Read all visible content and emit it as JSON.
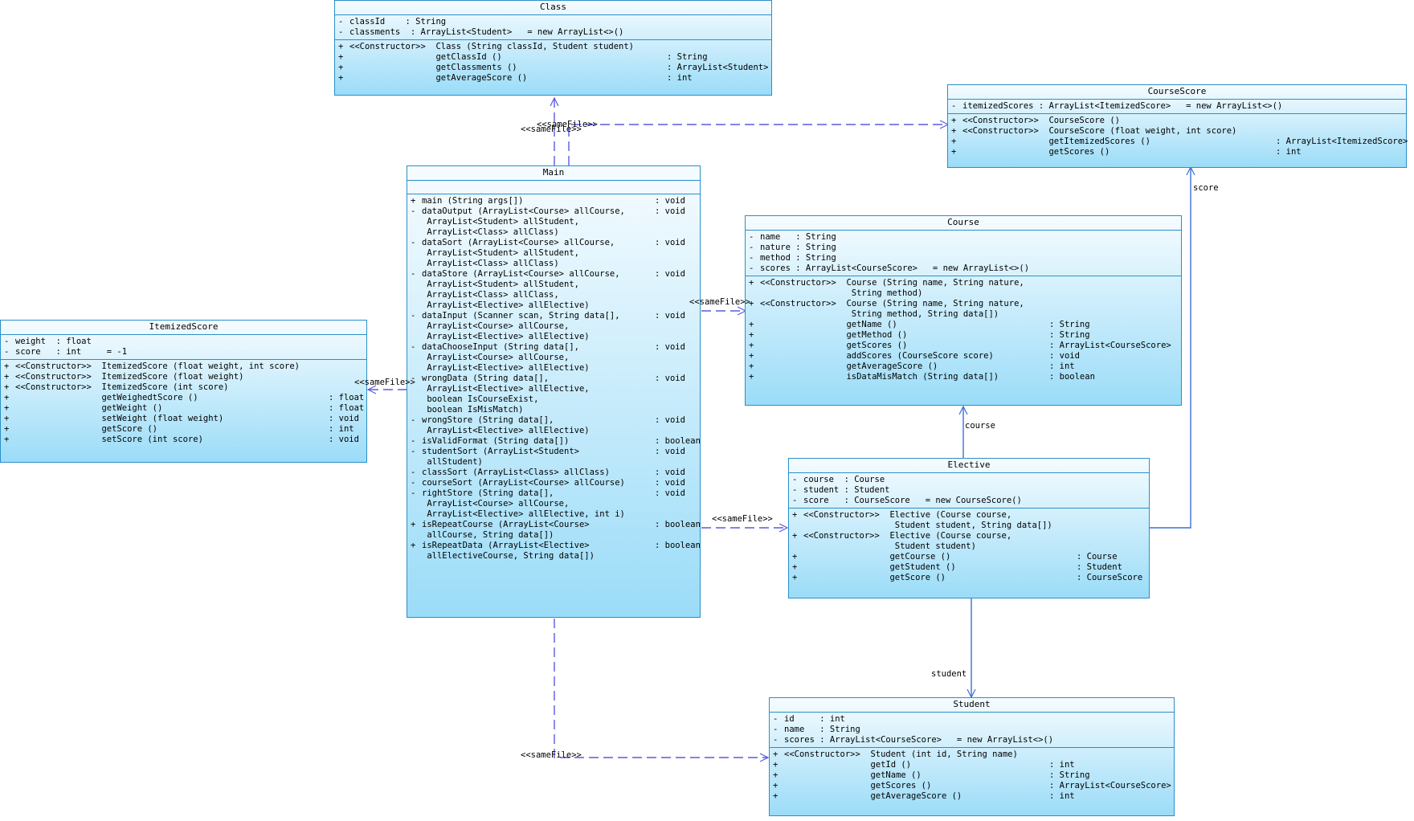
{
  "stereotype_label": "<<sameFile>>",
  "classes": {
    "class": {
      "title": "Class",
      "attrs": [
        {
          "vis": "-",
          "text": "classId    : String"
        },
        {
          "vis": "-",
          "text": "classments  : ArrayList<Student>   = new ArrayList<>()"
        }
      ],
      "ops": [
        {
          "vis": "+",
          "text": "<<Constructor>>  Class (String classId, Student student)",
          "ret": ""
        },
        {
          "vis": "+",
          "text": "                 getClassId ()",
          "ret": ": String"
        },
        {
          "vis": "+",
          "text": "                 getClassments ()",
          "ret": ": ArrayList<Student>"
        },
        {
          "vis": "+",
          "text": "                 getAverageScore ()",
          "ret": ": int"
        }
      ]
    },
    "course_score": {
      "title": "CourseScore",
      "attrs": [
        {
          "vis": "-",
          "text": "itemizedScores : ArrayList<ItemizedScore>   = new ArrayList<>()"
        }
      ],
      "ops": [
        {
          "vis": "+",
          "text": "<<Constructor>>  CourseScore ()",
          "ret": ""
        },
        {
          "vis": "+",
          "text": "<<Constructor>>  CourseScore (float weight, int score)",
          "ret": ""
        },
        {
          "vis": "+",
          "text": "                 getItemizedScores ()",
          "ret": ": ArrayList<ItemizedScore>"
        },
        {
          "vis": "+",
          "text": "                 getScores ()",
          "ret": ": int"
        }
      ]
    },
    "main": {
      "title": "Main",
      "attrs": [],
      "ops": [
        {
          "vis": "+",
          "text": "main (String args[])",
          "ret": ": void"
        },
        {
          "vis": "-",
          "text": "dataOutput (ArrayList<Course> allCourse,",
          "ret": ": void"
        },
        {
          "vis": "",
          "text": " ArrayList<Student> allStudent,",
          "ret": ""
        },
        {
          "vis": "",
          "text": " ArrayList<Class> allClass)",
          "ret": ""
        },
        {
          "vis": "-",
          "text": "dataSort (ArrayList<Course> allCourse,",
          "ret": ": void"
        },
        {
          "vis": "",
          "text": " ArrayList<Student> allStudent,",
          "ret": ""
        },
        {
          "vis": "",
          "text": " ArrayList<Class> allClass)",
          "ret": ""
        },
        {
          "vis": "-",
          "text": "dataStore (ArrayList<Course> allCourse,",
          "ret": ": void"
        },
        {
          "vis": "",
          "text": " ArrayList<Student> allStudent,",
          "ret": ""
        },
        {
          "vis": "",
          "text": " ArrayList<Class> allClass,",
          "ret": ""
        },
        {
          "vis": "",
          "text": " ArrayList<Elective> allElective)",
          "ret": ""
        },
        {
          "vis": "-",
          "text": "dataInput (Scanner scan, String data[],",
          "ret": ": void"
        },
        {
          "vis": "",
          "text": " ArrayList<Course> allCourse,",
          "ret": ""
        },
        {
          "vis": "",
          "text": " ArrayList<Elective> allElective)",
          "ret": ""
        },
        {
          "vis": "-",
          "text": "dataChooseInput (String data[],",
          "ret": ": void"
        },
        {
          "vis": "",
          "text": " ArrayList<Course> allCourse,",
          "ret": ""
        },
        {
          "vis": "",
          "text": " ArrayList<Elective> allElective)",
          "ret": ""
        },
        {
          "vis": "-",
          "text": "wrongData (String data[],",
          "ret": ": void"
        },
        {
          "vis": "",
          "text": " ArrayList<Elective> allElective,",
          "ret": ""
        },
        {
          "vis": "",
          "text": " boolean IsCourseExist,",
          "ret": ""
        },
        {
          "vis": "",
          "text": " boolean IsMisMatch)",
          "ret": ""
        },
        {
          "vis": "-",
          "text": "wrongStore (String data[],",
          "ret": ": void"
        },
        {
          "vis": "",
          "text": " ArrayList<Elective> allElective)",
          "ret": ""
        },
        {
          "vis": "-",
          "text": "isValidFormat (String data[])",
          "ret": ": boolean"
        },
        {
          "vis": "-",
          "text": "studentSort (ArrayList<Student>",
          "ret": ": void"
        },
        {
          "vis": "",
          "text": " allStudent)",
          "ret": ""
        },
        {
          "vis": "-",
          "text": "classSort (ArrayList<Class> allClass)",
          "ret": ": void"
        },
        {
          "vis": "-",
          "text": "courseSort (ArrayList<Course> allCourse)",
          "ret": ": void"
        },
        {
          "vis": "-",
          "text": "rightStore (String data[],",
          "ret": ": void"
        },
        {
          "vis": "",
          "text": " ArrayList<Course> allCourse,",
          "ret": ""
        },
        {
          "vis": "",
          "text": " ArrayList<Elective> allElective, int i)",
          "ret": ""
        },
        {
          "vis": "+",
          "text": "isRepeatCourse (ArrayList<Course>",
          "ret": ": boolean"
        },
        {
          "vis": "",
          "text": " allCourse, String data[])",
          "ret": ""
        },
        {
          "vis": "+",
          "text": "isRepeatData (ArrayList<Elective>",
          "ret": ": boolean"
        },
        {
          "vis": "",
          "text": " allElectiveCourse, String data[])",
          "ret": ""
        }
      ]
    },
    "course": {
      "title": "Course",
      "attrs": [
        {
          "vis": "-",
          "text": "name   : String"
        },
        {
          "vis": "-",
          "text": "nature : String"
        },
        {
          "vis": "-",
          "text": "method : String"
        },
        {
          "vis": "-",
          "text": "scores : ArrayList<CourseScore>   = new ArrayList<>()"
        }
      ],
      "ops": [
        {
          "vis": "+",
          "text": "<<Constructor>>  Course (String name, String nature,",
          "ret": ""
        },
        {
          "vis": "",
          "text": "                  String method)",
          "ret": ""
        },
        {
          "vis": "+",
          "text": "<<Constructor>>  Course (String name, String nature,",
          "ret": ""
        },
        {
          "vis": "",
          "text": "                  String method, String data[])",
          "ret": ""
        },
        {
          "vis": "+",
          "text": "                 getName ()",
          "ret": ": String"
        },
        {
          "vis": "+",
          "text": "                 getMethod ()",
          "ret": ": String"
        },
        {
          "vis": "+",
          "text": "                 getScores ()",
          "ret": ": ArrayList<CourseScore>"
        },
        {
          "vis": "+",
          "text": "                 addScores (CourseScore score)",
          "ret": ": void"
        },
        {
          "vis": "+",
          "text": "                 getAverageScore ()",
          "ret": ": int"
        },
        {
          "vis": "+",
          "text": "                 isDataMisMatch (String data[])",
          "ret": ": boolean"
        }
      ]
    },
    "itemized_score": {
      "title": "ItemizedScore",
      "attrs": [
        {
          "vis": "-",
          "text": "weight  : float"
        },
        {
          "vis": "-",
          "text": "score   : int     = -1"
        }
      ],
      "ops": [
        {
          "vis": "+",
          "text": "<<Constructor>>  ItemizedScore (float weight, int score)",
          "ret": ""
        },
        {
          "vis": "+",
          "text": "<<Constructor>>  ItemizedScore (float weight)",
          "ret": ""
        },
        {
          "vis": "+",
          "text": "<<Constructor>>  ItemizedScore (int score)",
          "ret": ""
        },
        {
          "vis": "+",
          "text": "                 getWeighedtScore ()",
          "ret": ": float"
        },
        {
          "vis": "+",
          "text": "                 getWeight ()",
          "ret": ": float"
        },
        {
          "vis": "+",
          "text": "                 setWeight (float weight)",
          "ret": ": void"
        },
        {
          "vis": "+",
          "text": "                 getScore ()",
          "ret": ": int"
        },
        {
          "vis": "+",
          "text": "                 setScore (int score)",
          "ret": ": void"
        }
      ]
    },
    "elective": {
      "title": "Elective",
      "attrs": [
        {
          "vis": "-",
          "text": "course  : Course"
        },
        {
          "vis": "-",
          "text": "student : Student"
        },
        {
          "vis": "-",
          "text": "score   : CourseScore   = new CourseScore()"
        }
      ],
      "ops": [
        {
          "vis": "+",
          "text": "<<Constructor>>  Elective (Course course,",
          "ret": ""
        },
        {
          "vis": "",
          "text": "                  Student student, String data[])",
          "ret": ""
        },
        {
          "vis": "+",
          "text": "<<Constructor>>  Elective (Course course,",
          "ret": ""
        },
        {
          "vis": "",
          "text": "                  Student student)",
          "ret": ""
        },
        {
          "vis": "+",
          "text": "                 getCourse ()",
          "ret": ": Course"
        },
        {
          "vis": "+",
          "text": "                 getStudent ()",
          "ret": ": Student"
        },
        {
          "vis": "+",
          "text": "                 getScore ()",
          "ret": ": CourseScore"
        }
      ]
    },
    "student": {
      "title": "Student",
      "attrs": [
        {
          "vis": "-",
          "text": "id     : int"
        },
        {
          "vis": "-",
          "text": "name   : String"
        },
        {
          "vis": "-",
          "text": "scores : ArrayList<CourseScore>   = new ArrayList<>()"
        }
      ],
      "ops": [
        {
          "vis": "+",
          "text": "<<Constructor>>  Student (int id, String name)",
          "ret": ""
        },
        {
          "vis": "+",
          "text": "                 getId ()",
          "ret": ": int"
        },
        {
          "vis": "+",
          "text": "                 getName ()",
          "ret": ": String"
        },
        {
          "vis": "+",
          "text": "                 getScores ()",
          "ret": ": ArrayList<CourseScore>"
        },
        {
          "vis": "+",
          "text": "                 getAverageScore ()",
          "ret": ": int"
        }
      ]
    }
  },
  "association_labels": {
    "score": "score",
    "course": "course",
    "student": "student"
  },
  "colors": {
    "box_border": "#2a8fc8",
    "line": "#3a6fd8",
    "dashed": "#5a5ae0"
  }
}
